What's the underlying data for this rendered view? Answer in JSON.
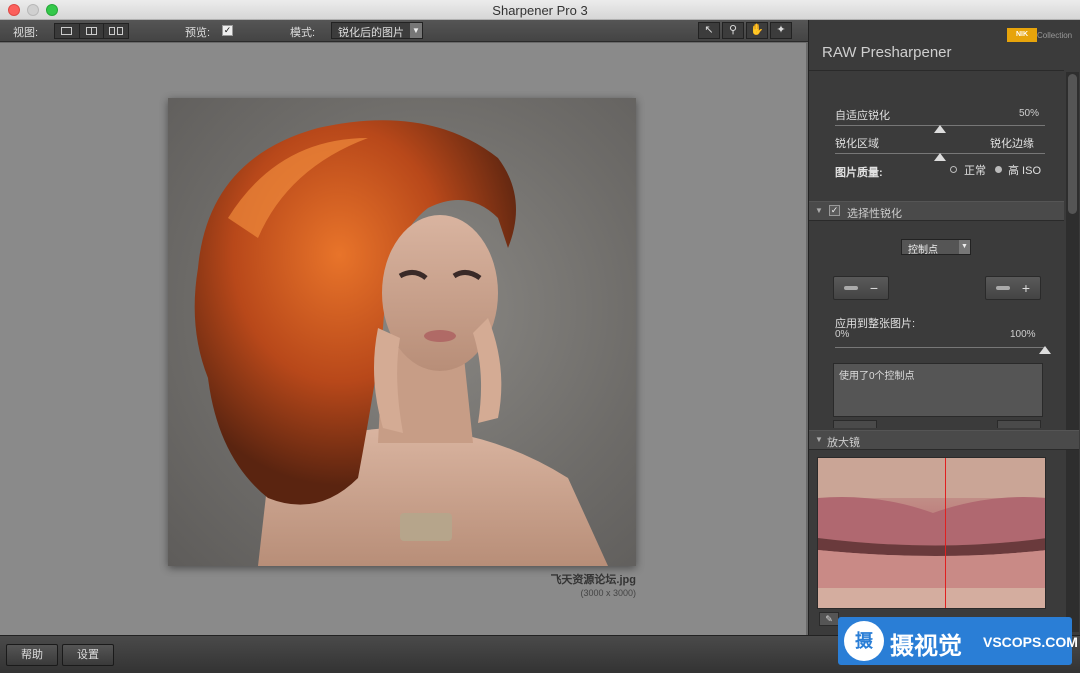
{
  "window": {
    "title": "Sharpener Pro 3"
  },
  "toolbar": {
    "view_label": "视图:",
    "preview_label": "预览:",
    "preview_checked": "✓",
    "mode_label": "模式:",
    "mode_value": "锐化后的图片",
    "tools": [
      "pointer-icon",
      "zoom-icon",
      "hand-icon",
      "brightness-icon"
    ]
  },
  "canvas": {
    "filename": "飞天资源论坛.jpg",
    "dimensions": "(3000 x 3000)"
  },
  "panel": {
    "brand_logo": "NIK",
    "brand_collection": "Collection",
    "title": "RAW Presharpener",
    "adaptive_label": "自适应锐化",
    "adaptive_value": "50%",
    "adaptive_level": 0.5,
    "area_left_label": "锐化区域",
    "area_right_label": "锐化边缘",
    "area_level": 0.5,
    "quality_label": "图片质量:",
    "quality_normal": "正常",
    "quality_high": "高 ISO",
    "quality_selected": "高 ISO",
    "selective_section": "选择性锐化",
    "selective_checked": "✓",
    "control_points_select": "控制点",
    "minus_symbol": "−",
    "plus_symbol": "+",
    "apply_label": "应用到整张图片:",
    "apply_min": "0%",
    "apply_max": "100%",
    "apply_level": 1.0,
    "list_text": "使用了0个控制点",
    "loupe_section": "放大镜"
  },
  "bottom": {
    "help_label": "帮助",
    "settings_label": "设置"
  },
  "watermark": {
    "logo_char": "摄",
    "text": "摄视觉",
    "url": "VSCOPS.COM"
  },
  "colors": {
    "accent_orange": "#e7a40b",
    "loupe_line": "#e02020",
    "watermark_blue": "#2a7ed6"
  }
}
